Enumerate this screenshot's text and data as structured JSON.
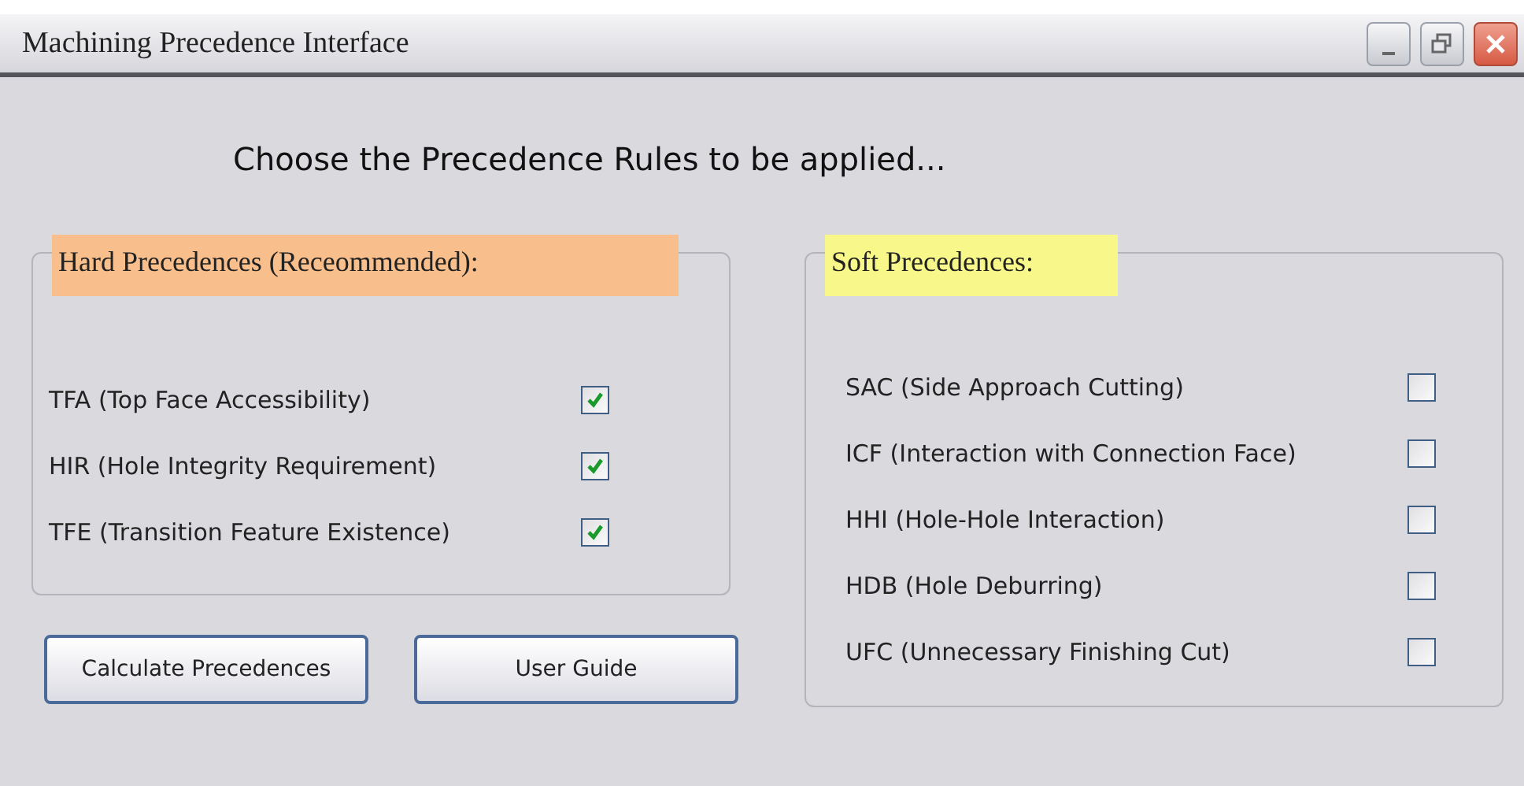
{
  "window": {
    "title": "Machining Precedence Interface"
  },
  "heading": "Choose the Precedence Rules to be applied...",
  "hard": {
    "legend": "Hard Precedences (Receommended):",
    "color": "#f8bf8c",
    "rules": [
      {
        "label": "TFA (Top Face Accessibility)",
        "checked": true
      },
      {
        "label": "HIR (Hole Integrity Requirement)",
        "checked": true
      },
      {
        "label": "TFE (Transition Feature Existence)",
        "checked": true
      }
    ]
  },
  "soft": {
    "legend": "Soft Precedences:",
    "color": "#f8f88a",
    "rules": [
      {
        "label": "SAC (Side Approach Cutting)",
        "checked": false
      },
      {
        "label": "ICF (Interaction with Connection Face)",
        "checked": false
      },
      {
        "label": "HHI (Hole-Hole Interaction)",
        "checked": false
      },
      {
        "label": "HDB (Hole Deburring)",
        "checked": false
      },
      {
        "label": "UFC (Unnecessary Finishing Cut)",
        "checked": false
      }
    ]
  },
  "buttons": [
    "Calculate Precedences",
    "User Guide"
  ]
}
